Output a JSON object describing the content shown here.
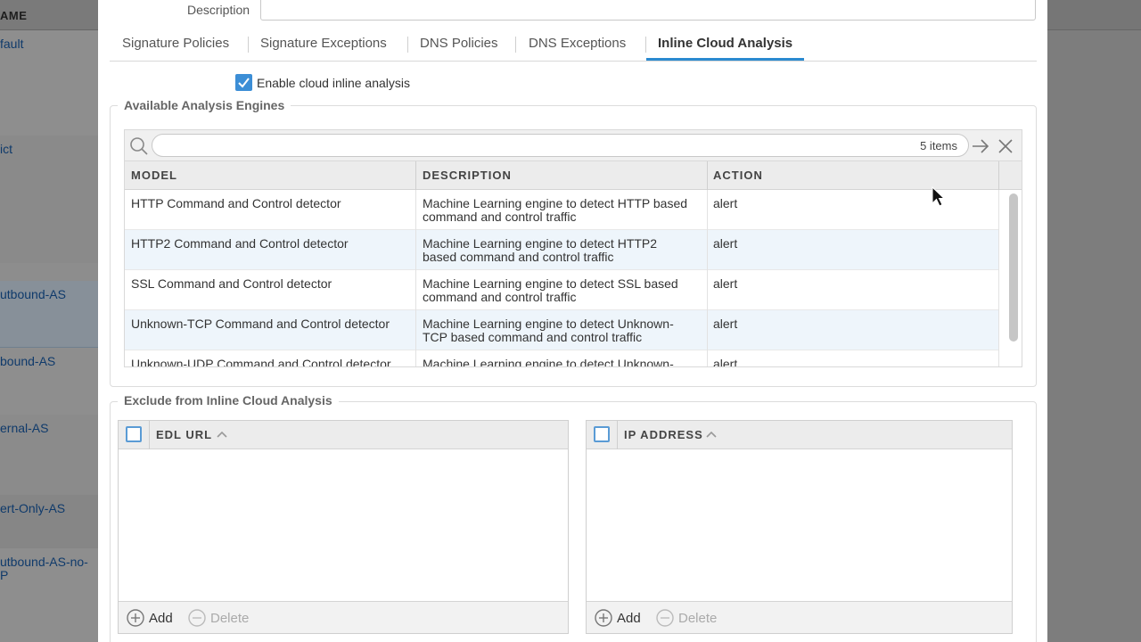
{
  "background_list": {
    "header": "AME",
    "items": [
      "fault",
      "ict",
      "utbound-AS",
      "bound-AS",
      "ernal-AS",
      "ert-Only-AS",
      "utbound-AS-no-",
      "P"
    ]
  },
  "form": {
    "description_label": "Description",
    "description_value": ""
  },
  "tabs": [
    {
      "label": "Signature Policies",
      "active": false
    },
    {
      "label": "Signature Exceptions",
      "active": false
    },
    {
      "label": "DNS Policies",
      "active": false
    },
    {
      "label": "DNS Exceptions",
      "active": false
    },
    {
      "label": "Inline Cloud Analysis",
      "active": true
    }
  ],
  "enable_cloud": {
    "label": "Enable cloud inline analysis",
    "checked": true
  },
  "engines": {
    "legend": "Available Analysis Engines",
    "search_value": "",
    "items_count": "5 items",
    "columns": [
      "MODEL",
      "DESCRIPTION",
      "ACTION"
    ],
    "rows": [
      {
        "model": "HTTP Command and Control detector",
        "description_1": "Machine Learning engine to detect HTTP based",
        "description_2": "command and control traffic",
        "action": "alert"
      },
      {
        "model": "HTTP2 Command and Control detector",
        "description_1": "Machine Learning engine to detect HTTP2",
        "description_2": "based command and control traffic",
        "action": "alert"
      },
      {
        "model": "SSL Command and Control detector",
        "description_1": "Machine Learning engine to detect SSL based",
        "description_2": "command and control traffic",
        "action": "alert"
      },
      {
        "model": "Unknown-TCP Command and Control detector",
        "description_1": "Machine Learning engine to detect Unknown-",
        "description_2": "TCP based command and control traffic",
        "action": "alert"
      },
      {
        "model": "Unknown-UDP Command and Control detector",
        "description_1": "Machine Learning engine to detect Unknown-",
        "description_2": "",
        "action": "alert"
      }
    ]
  },
  "exclude": {
    "legend": "Exclude from Inline Cloud Analysis",
    "edl_table": {
      "column": "EDL URL",
      "add_label": "Add",
      "delete_label": "Delete"
    },
    "ip_table": {
      "column": "IP ADDRESS",
      "add_label": "Add",
      "delete_label": "Delete"
    }
  },
  "colors": {
    "accent": "#2b8ad0",
    "checkbox": "#3c8ed6",
    "row_alt": "#eef5fb"
  }
}
